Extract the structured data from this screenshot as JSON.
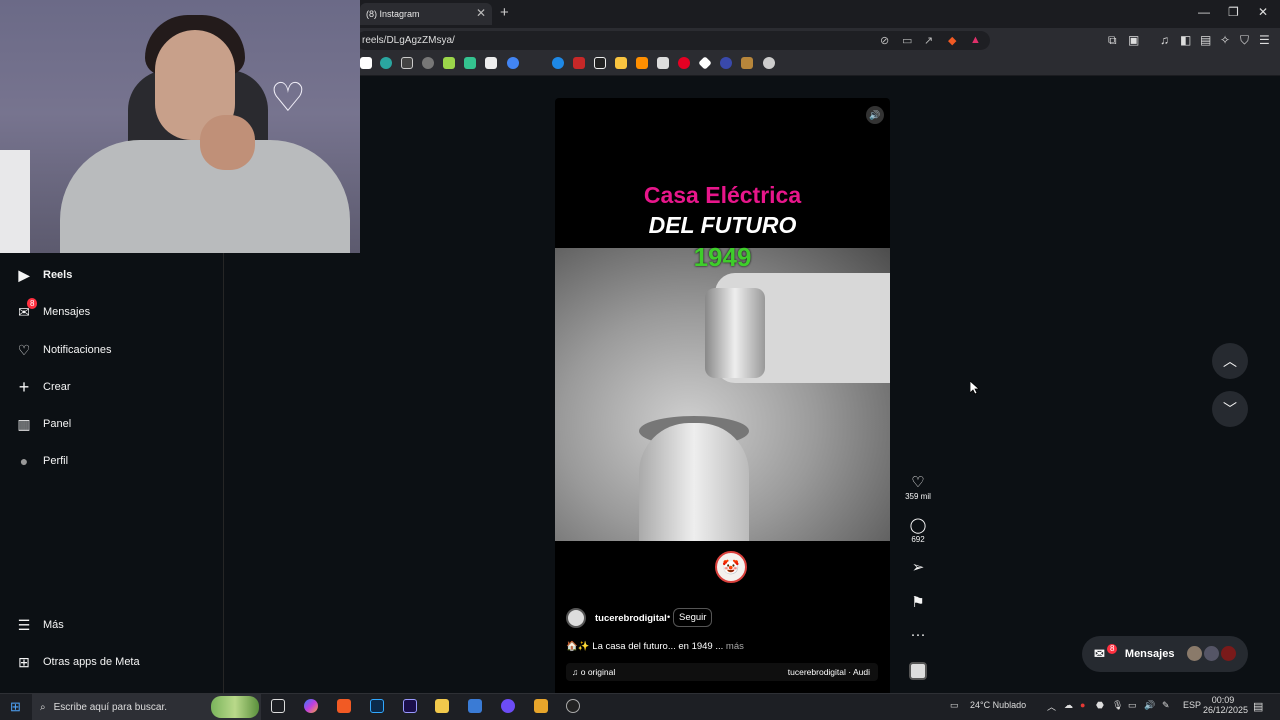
{
  "browser": {
    "tab_title": "(8) Instagram",
    "tab_close": "✕",
    "new_tab": "+",
    "url": "reels/DLgAgzZMsya/",
    "window_min": "—",
    "window_restore": "❐",
    "window_close": "✕"
  },
  "sidebar": {
    "items": [
      {
        "label": "Reels",
        "icon": "reels-icon",
        "glyph": "▶"
      },
      {
        "label": "Mensajes",
        "icon": "send-icon",
        "glyph": "✉",
        "badge": "8"
      },
      {
        "label": "Notificaciones",
        "icon": "heart-icon",
        "glyph": "♡"
      },
      {
        "label": "Crear",
        "icon": "plus-icon",
        "glyph": "+"
      },
      {
        "label": "Panel",
        "icon": "chart-icon",
        "glyph": "▥"
      },
      {
        "label": "Perfil",
        "icon": "avatar-icon",
        "glyph": "●"
      }
    ],
    "bottom": [
      {
        "label": "Más",
        "icon": "menu-icon",
        "glyph": "☰"
      },
      {
        "label": "Otras apps de Meta",
        "icon": "meta-apps-icon",
        "glyph": "⊞"
      }
    ]
  },
  "reel": {
    "title_line1": "Casa Eléctrica",
    "title_line2": "DEL FUTURO",
    "year": "1949",
    "username": "tucerebrodigital",
    "dot": "•",
    "follow": "Seguir",
    "caption": "🏠✨ La casa del futuro... en 1949 ...",
    "caption_more": "más",
    "audio_left": "♫ o original",
    "audio_right": "tucerebrodigital · Audi",
    "emoji": "🤡",
    "sound_icon": "🔊"
  },
  "actions": {
    "likes": "359 mil",
    "comments": "692"
  },
  "messages_pill": {
    "label": "Mensajes",
    "badge": "8"
  },
  "taskbar": {
    "search_placeholder": "Escribe aquí para buscar.",
    "weather": "24°C  Nublado",
    "lang": "ESP",
    "time": "00:09",
    "date": "26/12/2025"
  },
  "colors": {
    "accent_pink": "#e8168b",
    "year_green": "#3fcd2b",
    "badge_red": "#ff3040"
  }
}
